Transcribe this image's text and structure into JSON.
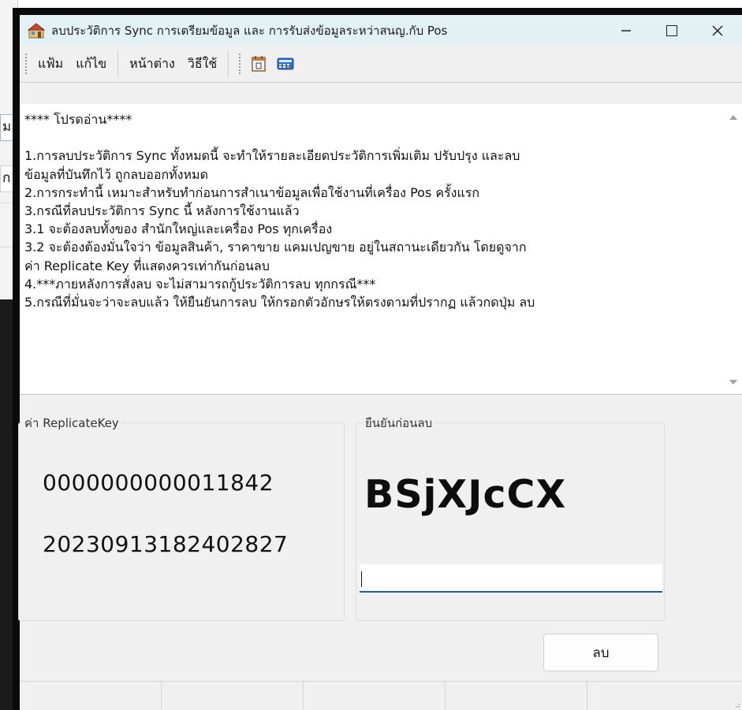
{
  "background_window": {
    "fragment_a": "ม",
    "fragment_b": "ก"
  },
  "window": {
    "title": "ลบประวัติการ Sync การเตรียมข้อมูล และ การรับส่งข้อมูลระหว่าสนญ.กับ Pos",
    "icon": "app-icon",
    "controls": [
      "minimize-icon",
      "maximize-icon",
      "close-icon"
    ]
  },
  "menu": {
    "items": [
      "แฟ้ม",
      "แก้ไข",
      "หน้าต่าง",
      "วิธีใช้"
    ],
    "tools": [
      "calendar-icon",
      "calculator-icon"
    ]
  },
  "notice": {
    "text": "**** โปรดอ่าน****\n\n1.การลบประวัติการ Sync ทั้งหมดนี้ จะทำให้รายละเอียดประวัติการเพิ่มเติม ปรับปรุง และลบ\nข้อมูลที่บันทึกไว้ ถูกลบออกทั้งหมด\n2.การกระทำนี้ เหมาะสำหรับทำก่อนการสำเนาข้อมูลเพื่อใช้งานที่เครื่อง Pos ครั้งแรก\n3.กรณีที่ลบประวัติการ Sync นี้ หลังการใช้งานแล้ว\n3.1 จะต้องลบทั้งของ สำนักใหญ่และเครื่อง Pos ทุกเครื่อง\n3.2 จะต้องต้องมั่นใจว่า ข้อมูลสินค้า, ราคาขาย แคมเปญขาย อยู่ในสถานะเดียวกัน โดยดูจาก\nค่า Replicate Key ที่แสดงควรเท่ากันก่อนลบ\n4.***ภายหลังการสั่งลบ จะไม่สามารถกู้ประวัติการลบ ทุกกรณี***\n5.กรณีที่มั่นจะว่าจะลบแล้ว ให้ยืนยันการลบ ให้กรอกตัวอักษรให้ตรงตามที่ปรากฏ แล้วกดปุ่ม ลบ"
  },
  "replicate": {
    "label": "ค่า ReplicateKey",
    "key1": "0000000000011842",
    "key2": "20230913182402827"
  },
  "confirm": {
    "label": "ยืนยันก่อนลบ",
    "code": "BSjXJcCX",
    "input_value": ""
  },
  "actions": {
    "delete_label": "ลบ"
  }
}
